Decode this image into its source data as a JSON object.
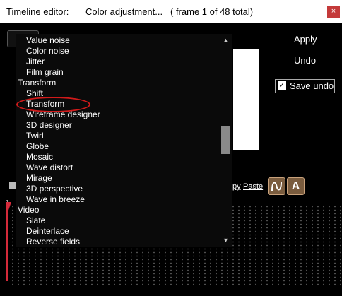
{
  "titlebar": {
    "label": "Timeline editor:",
    "document": "Color adjustment...",
    "frame_info": "( frame 1 of  48 total)",
    "close_glyph": "×"
  },
  "right_panel": {
    "apply": "Apply",
    "undo": "Undo",
    "save_undo": "Save undo",
    "save_undo_checked": true
  },
  "links": {
    "copy": "py",
    "paste": "Paste"
  },
  "icon_buttons": {
    "curve": "curve-icon",
    "text_a": "A"
  },
  "timeline": {
    "ruler_mark": "1"
  },
  "dropdown": {
    "items": [
      {
        "label": "Value noise",
        "level": "sub"
      },
      {
        "label": "Color noise",
        "level": "sub"
      },
      {
        "label": "Jitter",
        "level": "sub"
      },
      {
        "label": "Film grain",
        "level": "sub"
      },
      {
        "label": "Transform",
        "level": "cat"
      },
      {
        "label": "Shift",
        "level": "sub"
      },
      {
        "label": "Transform",
        "level": "sub"
      },
      {
        "label": "Wireframe designer",
        "level": "sub"
      },
      {
        "label": "3D designer",
        "level": "sub"
      },
      {
        "label": "Twirl",
        "level": "sub"
      },
      {
        "label": "Globe",
        "level": "sub"
      },
      {
        "label": "Mosaic",
        "level": "sub"
      },
      {
        "label": "Wave distort",
        "level": "sub"
      },
      {
        "label": "Mirage",
        "level": "sub"
      },
      {
        "label": "3D perspective",
        "level": "sub"
      },
      {
        "label": "Wave in breeze",
        "level": "sub"
      },
      {
        "label": "Video",
        "level": "cat"
      },
      {
        "label": "Slate",
        "level": "sub"
      },
      {
        "label": "Deinterlace",
        "level": "sub"
      },
      {
        "label": "Reverse fields",
        "level": "sub"
      }
    ],
    "highlighted_item": "Transform",
    "scroll_up": "▲",
    "scroll_down": "▼"
  },
  "colors": {
    "close": "#c43a3a",
    "highlight_ring": "#d21a1a",
    "playhead": "#d42a3a",
    "icon_button": "#7a5c3e"
  }
}
